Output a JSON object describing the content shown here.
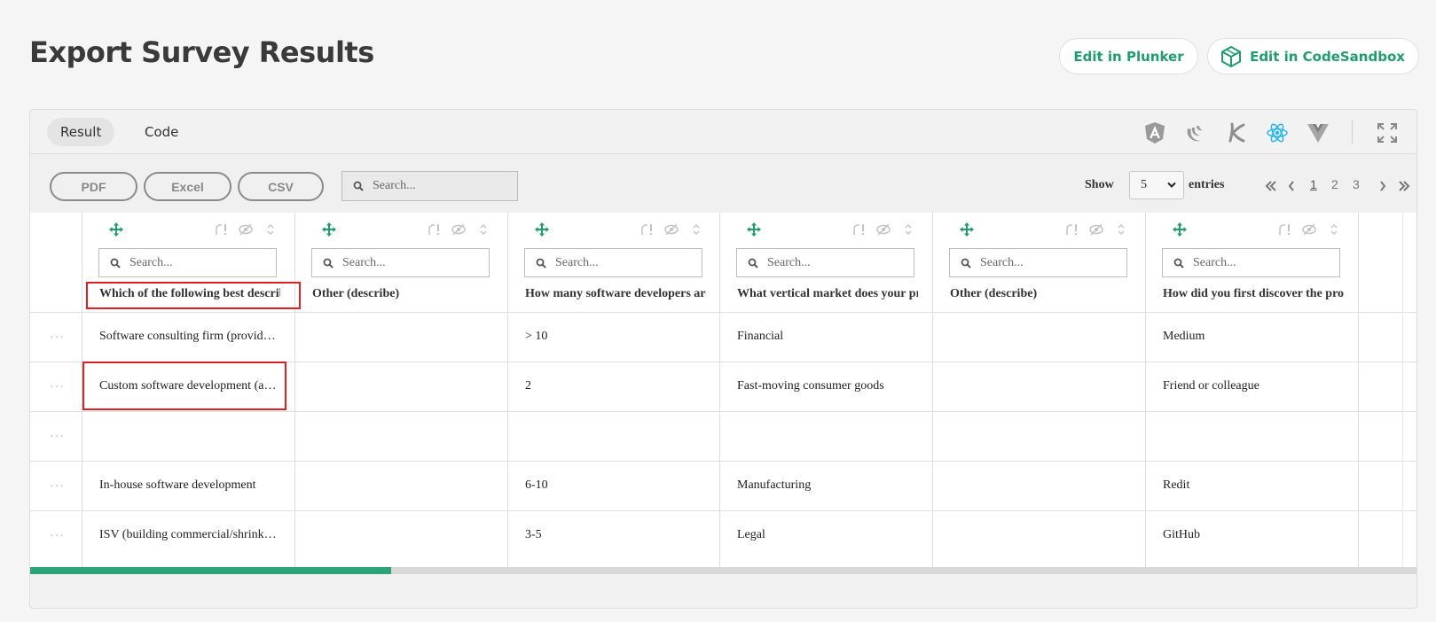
{
  "page": {
    "title": "Export Survey Results"
  },
  "header_buttons": {
    "plunker": "Edit in Plunker",
    "codesandbox": "Edit in CodeSandbox"
  },
  "demo_tabs": {
    "result": "Result",
    "code": "Code"
  },
  "frameworks": [
    "angular-icon",
    "jquery-icon",
    "knockout-icon",
    "react-icon",
    "vue-icon"
  ],
  "accent_color": "#1f9d6e",
  "toolbar": {
    "export_pdf": "PDF",
    "export_excel": "Excel",
    "export_csv": "CSV",
    "search_placeholder": "Search...",
    "show_label": "Show",
    "show_value": "5",
    "entries_label": "entries",
    "pages": [
      "1",
      "2",
      "3"
    ],
    "current_page": "1"
  },
  "columns": [
    {
      "title": "Which of the following best describes",
      "search_placeholder": "Search..."
    },
    {
      "title": "Other (describe)",
      "search_placeholder": "Search..."
    },
    {
      "title": "How many software developers are",
      "search_placeholder": "Search..."
    },
    {
      "title": "What vertical market does your pro",
      "search_placeholder": "Search..."
    },
    {
      "title": "Other (describe)",
      "search_placeholder": "Search..."
    },
    {
      "title": "How did you first discover the produ",
      "search_placeholder": "Search..."
    }
  ],
  "rows": [
    [
      "Software consulting firm (provide …",
      "",
      "> 10",
      "Financial",
      "",
      "Medium"
    ],
    [
      "Custom software development (as …",
      "",
      "2",
      "Fast-moving consumer goods",
      "",
      "Friend or colleague"
    ],
    [
      "",
      "",
      "",
      "",
      "",
      ""
    ],
    [
      "In-house software development",
      "",
      "6-10",
      "Manufacturing",
      "",
      "Redit"
    ],
    [
      "ISV (building commercial/shrink …",
      "",
      "3-5",
      "Legal",
      "",
      "GitHub"
    ]
  ],
  "row_menu_glyph": "···",
  "scroll_progress": 0.26
}
